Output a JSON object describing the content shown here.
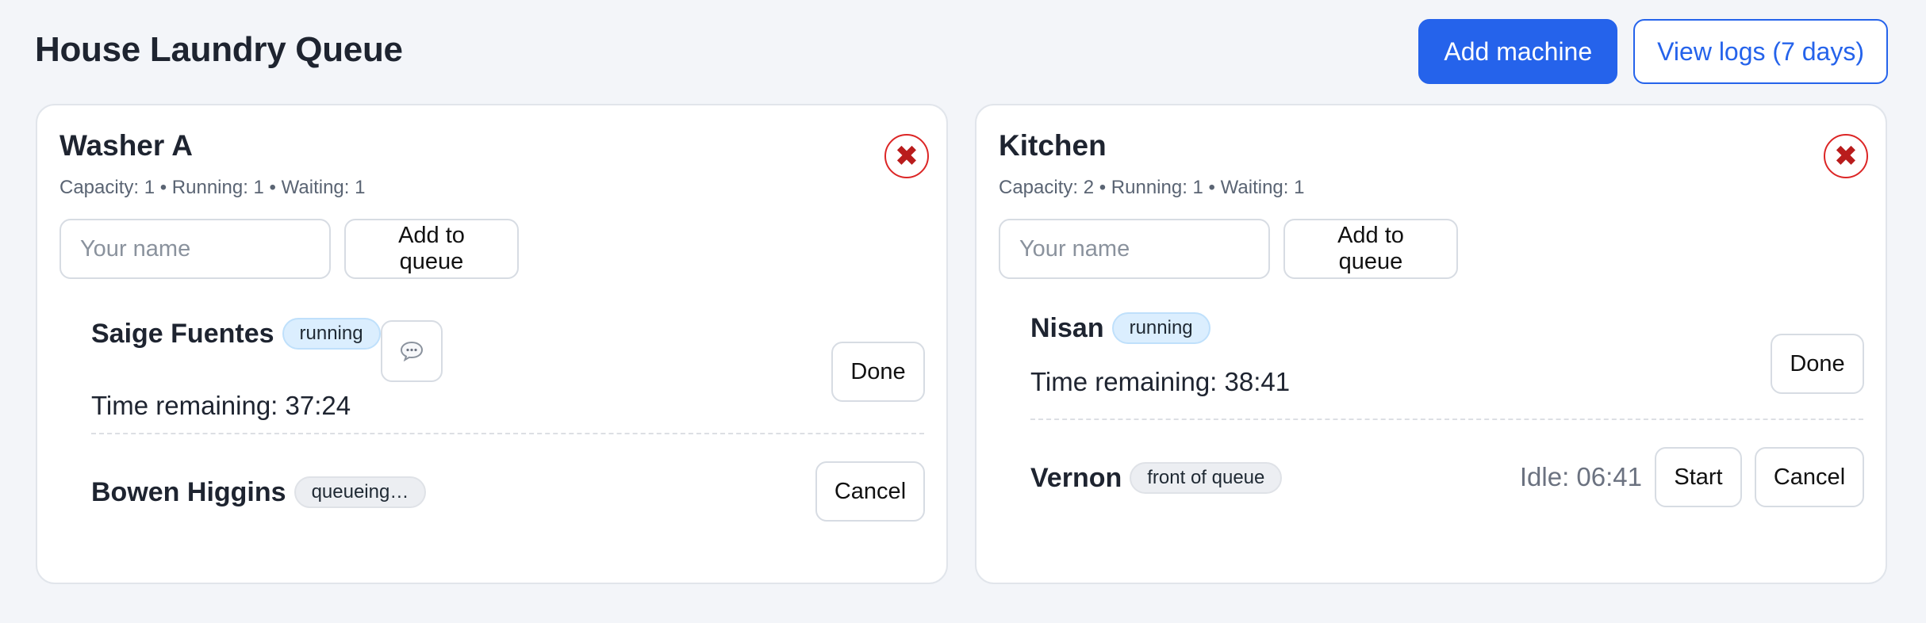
{
  "header": {
    "title": "House Laundry Queue",
    "add_machine": "Add machine",
    "view_logs": "View logs (7 days)"
  },
  "colors": {
    "primary": "#2563eb",
    "danger": "#dc2626",
    "running_badge": "#dbeefe"
  },
  "machines": [
    {
      "name": "Washer A",
      "meta": "Capacity: 1 • Running: 1 • Waiting: 1",
      "close_icon": "✖",
      "name_placeholder": "Your name",
      "add_label": "Add to queue",
      "entries": [
        {
          "name": "Saige Fuentes",
          "status": "running",
          "timer": "Time remaining: 37:24",
          "action": "Done",
          "icon": "speech-bubble-icon"
        },
        {
          "name": "Bowen Higgins",
          "status": "queueing…",
          "action": "Cancel"
        }
      ]
    },
    {
      "name": "Kitchen",
      "meta": "Capacity: 2 • Running: 1 • Waiting: 1",
      "close_icon": "✖",
      "name_placeholder": "Your name",
      "add_label": "Add to queue",
      "entries": [
        {
          "name": "Nisan",
          "status": "running",
          "timer": "Time remaining: 38:41",
          "action": "Done"
        },
        {
          "name": "Vernon",
          "status": "front of queue",
          "idle": "Idle: 06:41",
          "start": "Start",
          "action": "Cancel"
        }
      ]
    }
  ]
}
